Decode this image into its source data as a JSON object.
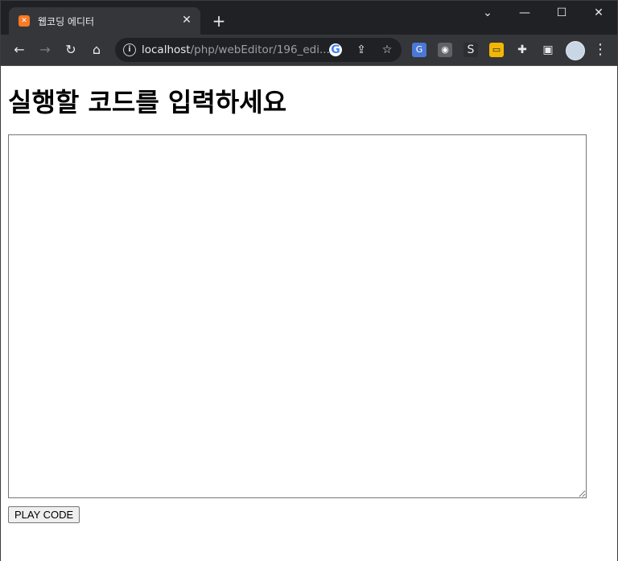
{
  "browser": {
    "tab": {
      "title": "웹코딩 에디터",
      "favicon": "xampp-icon"
    },
    "new_tab_label": "+",
    "window_controls": {
      "dropdown": "⌄",
      "minimize": "—",
      "maximize": "☐",
      "close": "✕"
    },
    "toolbar": {
      "back": "←",
      "forward": "→",
      "reload": "↻",
      "home": "⌂",
      "url_host": "localhost",
      "url_path": "/php/webEditor/196_edi...",
      "info_icon": "i"
    },
    "extensions": [
      "translate-icon",
      "camera-icon",
      "s-extension-icon",
      "folder-extension-icon",
      "puzzle-icon",
      "sidepanel-icon"
    ],
    "menu": "⋮"
  },
  "page": {
    "heading": "실행할 코드를 입력하세요",
    "textarea_value": "",
    "play_button_label": "PLAY CODE"
  },
  "colors": {
    "frame": "#202124",
    "toolbar": "#35363a",
    "tab_favicon": "#fb7a24"
  }
}
